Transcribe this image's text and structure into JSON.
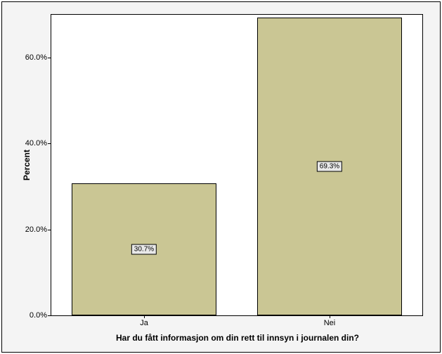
{
  "chart_data": {
    "type": "bar",
    "categories": [
      "Ja",
      "Nei"
    ],
    "values": [
      30.7,
      69.3
    ],
    "value_labels": [
      "30.7%",
      "69.3%"
    ],
    "ylabel": "Percent",
    "xlabel": "Har du fått informasjon om din rett til innsyn i journalen din?",
    "ylim": [
      0,
      70
    ],
    "yticks": [
      0.0,
      20.0,
      40.0,
      60.0
    ],
    "ytick_labels": [
      "0.0%",
      "20.0%",
      "40.0%",
      "60.0%"
    ]
  }
}
